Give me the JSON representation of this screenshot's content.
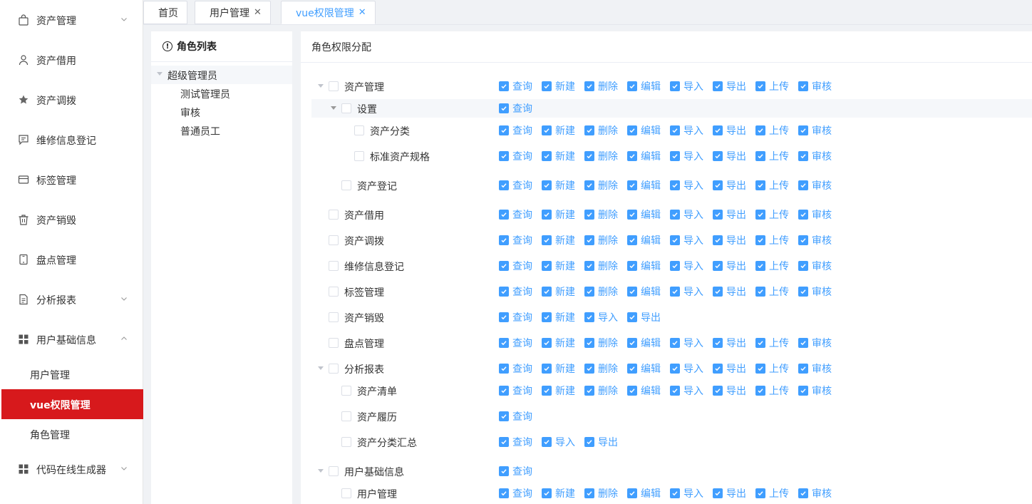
{
  "sidebar": {
    "items": [
      {
        "label": "资产管理",
        "icon": "bag-icon",
        "chevron": "down"
      },
      {
        "label": "资产借用",
        "icon": "user-icon",
        "chevron": ""
      },
      {
        "label": "资产调拨",
        "icon": "star-icon",
        "chevron": ""
      },
      {
        "label": "维修信息登记",
        "icon": "chat-icon",
        "chevron": ""
      },
      {
        "label": "标签管理",
        "icon": "card-icon",
        "chevron": ""
      },
      {
        "label": "资产销毁",
        "icon": "trash-icon",
        "chevron": ""
      },
      {
        "label": "盘点管理",
        "icon": "tablet-icon",
        "chevron": ""
      },
      {
        "label": "分析报表",
        "icon": "doc-icon",
        "chevron": "down"
      },
      {
        "label": "用户基础信息",
        "icon": "grid-icon",
        "chevron": "up"
      }
    ],
    "submenu": [
      {
        "label": "用户管理",
        "active": false
      },
      {
        "label": "vue权限管理",
        "active": true
      },
      {
        "label": "角色管理",
        "active": false
      }
    ],
    "last_item": {
      "label": "代码在线生成器",
      "icon": "grid-icon",
      "chevron": "down"
    }
  },
  "tabs": [
    {
      "label": "首页",
      "closable": false,
      "active": false
    },
    {
      "label": "用户管理",
      "closable": true,
      "active": false
    },
    {
      "label": "vue权限管理",
      "closable": true,
      "active": true
    }
  ],
  "role_panel": {
    "title": "角色列表",
    "roles": [
      {
        "label": "超级管理员",
        "level": 0
      },
      {
        "label": "测试管理员",
        "level": 1
      },
      {
        "label": "审核",
        "level": 1
      },
      {
        "label": "普通员工",
        "level": 1
      }
    ]
  },
  "perm_panel": {
    "title": "角色权限分配",
    "rows": [
      {
        "label": "资产管理",
        "level": 0,
        "expand": true,
        "ops": [
          "查询",
          "新建",
          "删除",
          "编辑",
          "导入",
          "导出",
          "上传",
          "审核"
        ]
      },
      {
        "label": "设置",
        "level": 1,
        "expand": true,
        "ops": [
          "查询"
        ]
      },
      {
        "label": "资产分类",
        "level": 2,
        "expand": false,
        "ops": [
          "查询",
          "新建",
          "删除",
          "编辑",
          "导入",
          "导出",
          "上传",
          "审核"
        ]
      },
      {
        "label": "标准资产规格",
        "level": 2,
        "expand": false,
        "ops": [
          "查询",
          "新建",
          "删除",
          "编辑",
          "导入",
          "导出",
          "上传",
          "审核"
        ]
      },
      {
        "label": "资产登记",
        "level": 1,
        "expand": false,
        "ops": [
          "查询",
          "新建",
          "删除",
          "编辑",
          "导入",
          "导出",
          "上传",
          "审核"
        ]
      },
      {
        "label": "资产借用",
        "level": 0,
        "expand": false,
        "ops": [
          "查询",
          "新建",
          "删除",
          "编辑",
          "导入",
          "导出",
          "上传",
          "审核"
        ]
      },
      {
        "label": "资产调拨",
        "level": 0,
        "expand": false,
        "ops": [
          "查询",
          "新建",
          "删除",
          "编辑",
          "导入",
          "导出",
          "上传",
          "审核"
        ]
      },
      {
        "label": "维修信息登记",
        "level": 0,
        "expand": false,
        "ops": [
          "查询",
          "新建",
          "删除",
          "编辑",
          "导入",
          "导出",
          "上传",
          "审核"
        ]
      },
      {
        "label": "标签管理",
        "level": 0,
        "expand": false,
        "ops": [
          "查询",
          "新建",
          "删除",
          "编辑",
          "导入",
          "导出",
          "上传",
          "审核"
        ]
      },
      {
        "label": "资产销毁",
        "level": 0,
        "expand": false,
        "ops": [
          "查询",
          "新建",
          "导入",
          "导出"
        ]
      },
      {
        "label": "盘点管理",
        "level": 0,
        "expand": false,
        "ops": [
          "查询",
          "新建",
          "删除",
          "编辑",
          "导入",
          "导出",
          "上传",
          "审核"
        ]
      },
      {
        "label": "分析报表",
        "level": 0,
        "expand": true,
        "ops": [
          "查询",
          "新建",
          "删除",
          "编辑",
          "导入",
          "导出",
          "上传",
          "审核"
        ]
      },
      {
        "label": "资产清单",
        "level": 1,
        "expand": false,
        "ops": [
          "查询",
          "新建",
          "删除",
          "编辑",
          "导入",
          "导出",
          "上传",
          "审核"
        ]
      },
      {
        "label": "资产履历",
        "level": 1,
        "expand": false,
        "ops": [
          "查询"
        ]
      },
      {
        "label": "资产分类汇总",
        "level": 1,
        "expand": false,
        "ops": [
          "查询",
          "导入",
          "导出"
        ]
      },
      {
        "label": "用户基础信息",
        "level": 0,
        "expand": true,
        "ops": [
          "查询"
        ]
      },
      {
        "label": "用户管理",
        "level": 1,
        "expand": false,
        "ops": [
          "查询",
          "新建",
          "删除",
          "编辑",
          "导入",
          "导出",
          "上传",
          "审核"
        ]
      }
    ]
  },
  "colors": {
    "accent": "#409eff",
    "active_menu": "#d7191c"
  }
}
